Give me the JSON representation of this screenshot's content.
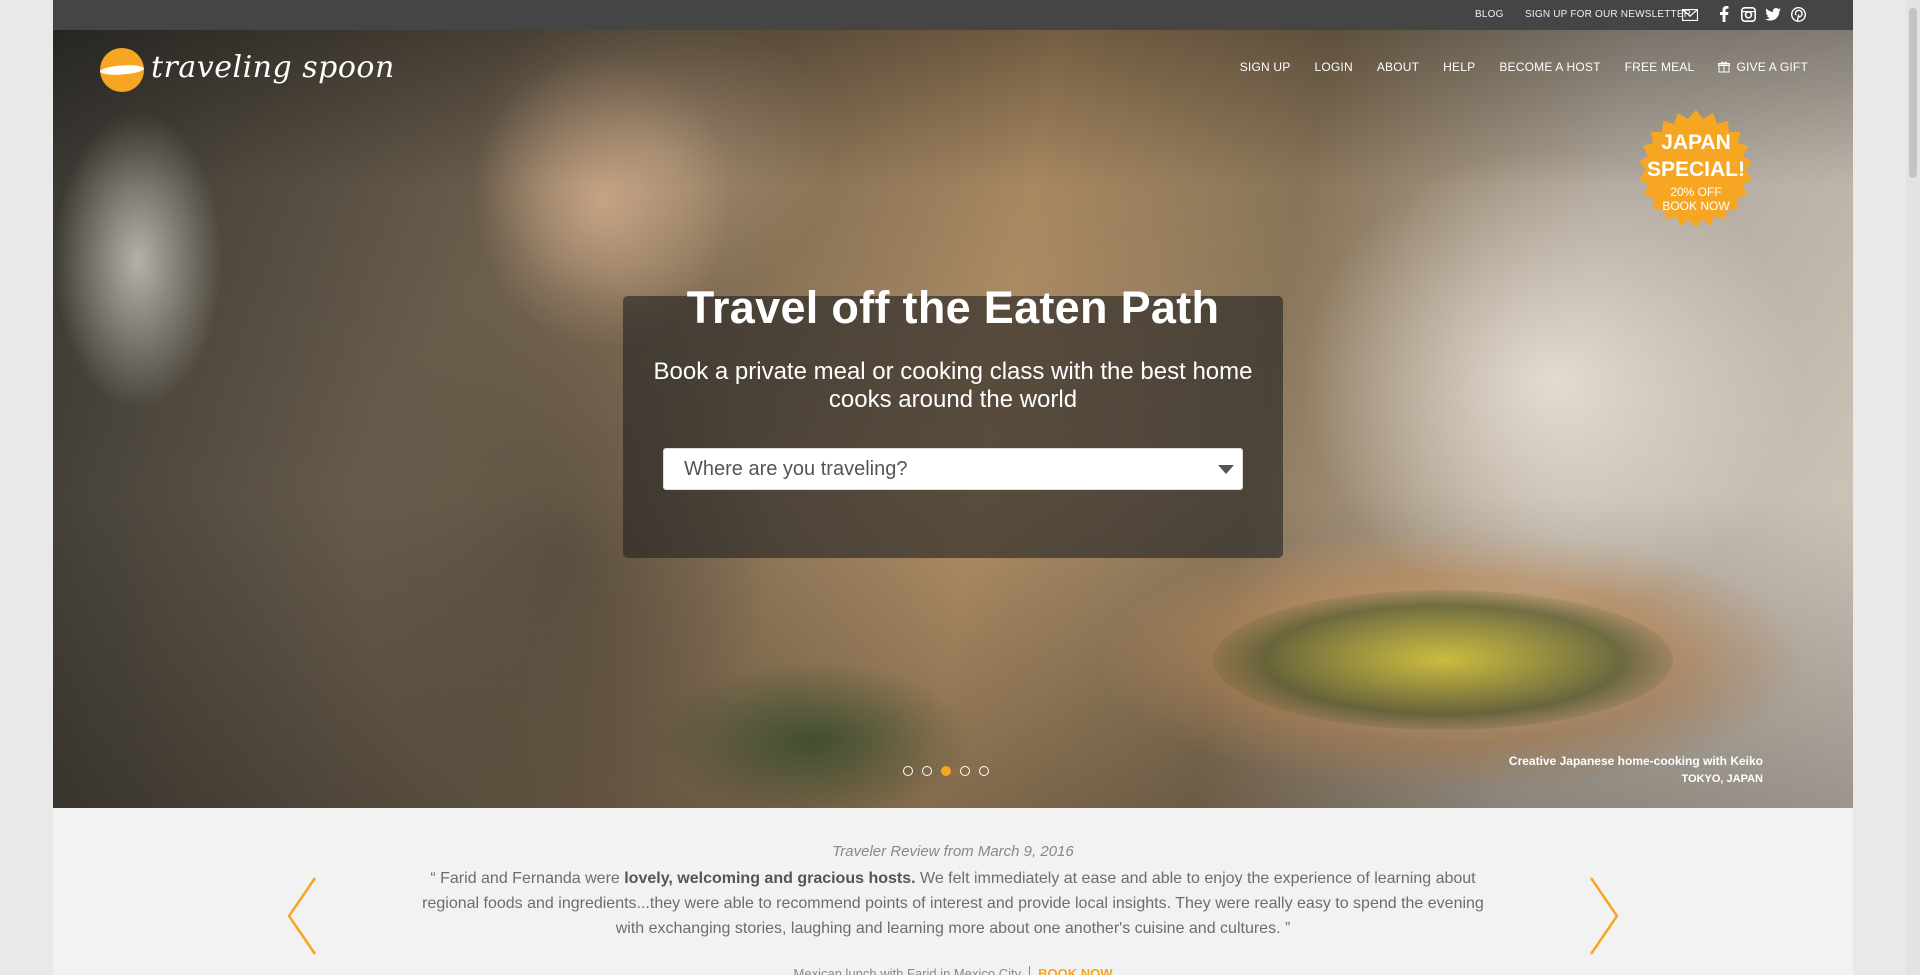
{
  "topbar": {
    "blog": "BLOG",
    "newsletter": "SIGN UP FOR OUR NEWSLETTER",
    "social": [
      "facebook-icon",
      "instagram-icon",
      "twitter-icon",
      "pinterest-icon"
    ]
  },
  "brand": {
    "name": "traveling spoon",
    "accent": "#f6a623"
  },
  "nav": {
    "signup": "SIGN UP",
    "login": "LOGIN",
    "about": "ABOUT",
    "help": "HELP",
    "host": "BECOME A HOST",
    "free_meal": "FREE MEAL",
    "gift": "GIVE A GIFT"
  },
  "badge": {
    "line1": "JAPAN",
    "line2": "SPECIAL!",
    "line3": "20% OFF",
    "line4": "BOOK NOW"
  },
  "hero": {
    "headline": "Travel off the Eaten Path",
    "subline": "Book a private meal or cooking class with the best home cooks around the world",
    "search_placeholder": "Where are you traveling?",
    "caption_title": "Creative Japanese home-cooking with Keiko",
    "caption_location": "TOKYO, JAPAN",
    "slide_count": 5,
    "active_slide": 3
  },
  "review": {
    "heading": "Traveler Review from March 9, 2016",
    "open_quote": "“ Farid and Fernanda were ",
    "bold": "lovely, welcoming and gracious hosts.",
    "rest": " We felt immediately at ease and able to enjoy the experience of learning about regional foods and ingredients...they were able to recommend points of interest and provide local insights. They were really easy to spend the evening with exchanging stories, laughing and learning more about one another's cuisine and cultures. ”",
    "footer": "Mexican lunch with Farid in Mexico City",
    "book": "BOOK NOW"
  }
}
